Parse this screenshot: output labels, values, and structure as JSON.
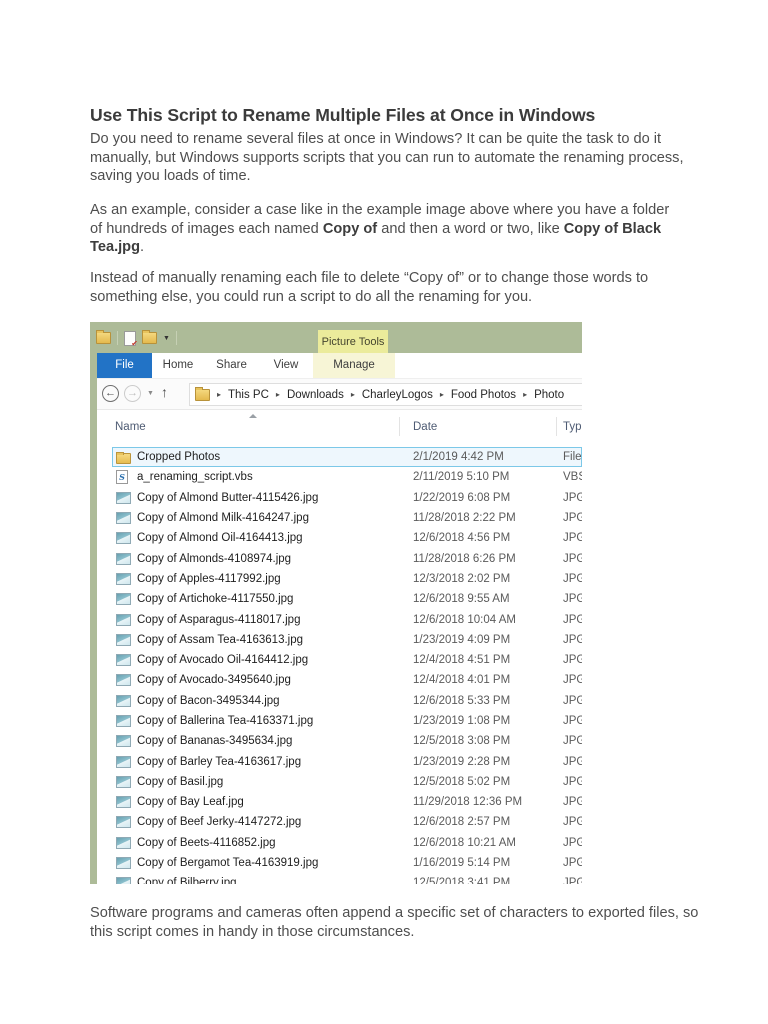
{
  "article": {
    "title": "Use This Script to Rename Multiple Files at Once in Windows",
    "p1": "Do you need to rename several files at once in Windows? It can be quite the task to do it manually, but Windows supports scripts that you can run to automate the renaming process, saving you loads of time.",
    "p2": {
      "s1": "As an example, consider a case like in the example image above where you have a folder of hundreds of images each named ",
      "b1": "Copy of",
      "s2": " and then a word or two, like ",
      "b2": "Copy of Black Tea.jpg",
      "s3": "."
    },
    "p3": "Instead of manually renaming each file to delete “Copy of” or to change those words to something else, you could run a script to do all the renaming for you.",
    "p4": "Software programs and cameras often append a specific set of characters to exported files, so this script comes in handy in those circumstances."
  },
  "explorer": {
    "contextual_tab_group": "Picture Tools",
    "tabs": [
      "File",
      "Home",
      "Share",
      "View",
      "Manage"
    ],
    "breadcrumb": [
      "This PC",
      "Downloads",
      "CharleyLogos",
      "Food Photos",
      "Photo"
    ],
    "columns": [
      "Name",
      "Date",
      "Type"
    ],
    "colors": {
      "desktop_green": "#adbb98",
      "picture_tools_yellow": "#ebeb9b",
      "file_tab_blue": "#2273c6",
      "selection_border": "#7cc8e8"
    },
    "files": [
      {
        "icon": "folder",
        "name": "Cropped Photos",
        "date": "2/1/2019 4:42 PM",
        "type": "File folder",
        "selected": true
      },
      {
        "icon": "vbs",
        "name": "a_renaming_script.vbs",
        "date": "2/11/2019 5:10 PM",
        "type": "VBScript Script File"
      },
      {
        "icon": "image",
        "name": "Copy of Almond Butter-4115426.jpg",
        "date": "1/22/2019 6:08 PM",
        "type": "JPG File"
      },
      {
        "icon": "image",
        "name": "Copy of Almond Milk-4164247.jpg",
        "date": "11/28/2018 2:22 PM",
        "type": "JPG File"
      },
      {
        "icon": "image",
        "name": "Copy of Almond Oil-4164413.jpg",
        "date": "12/6/2018 4:56 PM",
        "type": "JPG File"
      },
      {
        "icon": "image",
        "name": "Copy of Almonds-4108974.jpg",
        "date": "11/28/2018 6:26 PM",
        "type": "JPG File"
      },
      {
        "icon": "image",
        "name": "Copy of Apples-4117992.jpg",
        "date": "12/3/2018 2:02 PM",
        "type": "JPG File"
      },
      {
        "icon": "image",
        "name": "Copy of Artichoke-4117550.jpg",
        "date": "12/6/2018 9:55 AM",
        "type": "JPG File"
      },
      {
        "icon": "image",
        "name": "Copy of Asparagus-4118017.jpg",
        "date": "12/6/2018 10:04 AM",
        "type": "JPG File"
      },
      {
        "icon": "image",
        "name": "Copy of Assam Tea-4163613.jpg",
        "date": "1/23/2019 4:09 PM",
        "type": "JPG File"
      },
      {
        "icon": "image",
        "name": "Copy of Avocado Oil-4164412.jpg",
        "date": "12/4/2018 4:51 PM",
        "type": "JPG File"
      },
      {
        "icon": "image",
        "name": "Copy of Avocado-3495640.jpg",
        "date": "12/4/2018 4:01 PM",
        "type": "JPG File"
      },
      {
        "icon": "image",
        "name": "Copy of Bacon-3495344.jpg",
        "date": "12/6/2018 5:33 PM",
        "type": "JPG File"
      },
      {
        "icon": "image",
        "name": "Copy of Ballerina Tea-4163371.jpg",
        "date": "1/23/2019 1:08 PM",
        "type": "JPG File"
      },
      {
        "icon": "image",
        "name": "Copy of Bananas-3495634.jpg",
        "date": "12/5/2018 3:08 PM",
        "type": "JPG File"
      },
      {
        "icon": "image",
        "name": "Copy of Barley Tea-4163617.jpg",
        "date": "1/23/2019 2:28 PM",
        "type": "JPG File"
      },
      {
        "icon": "image",
        "name": "Copy of Basil.jpg",
        "date": "12/5/2018 5:02 PM",
        "type": "JPG File"
      },
      {
        "icon": "image",
        "name": "Copy of Bay Leaf.jpg",
        "date": "11/29/2018 12:36 PM",
        "type": "JPG File"
      },
      {
        "icon": "image",
        "name": "Copy of Beef Jerky-4147272.jpg",
        "date": "12/6/2018 2:57 PM",
        "type": "JPG File"
      },
      {
        "icon": "image",
        "name": "Copy of Beets-4116852.jpg",
        "date": "12/6/2018 10:21 AM",
        "type": "JPG File"
      },
      {
        "icon": "image",
        "name": "Copy of Bergamot Tea-4163919.jpg",
        "date": "1/16/2019 5:14 PM",
        "type": "JPG File"
      },
      {
        "icon": "image",
        "name": "Copy of Bilberry.jpg",
        "date": "12/5/2018 3:41 PM",
        "type": "JPG File"
      }
    ]
  }
}
